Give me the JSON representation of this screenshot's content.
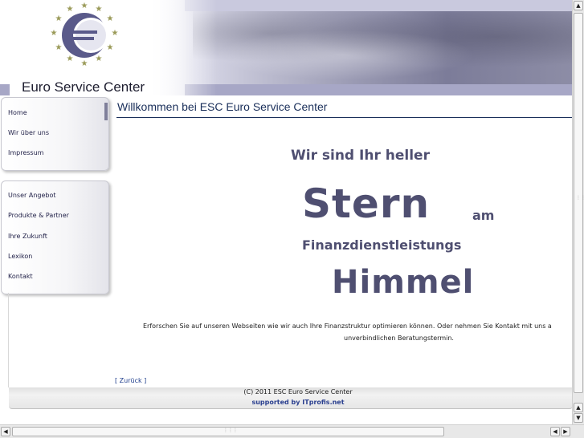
{
  "header": {
    "logo_text": "Euro Service Center"
  },
  "sidebar": {
    "group1": [
      {
        "label": "Home"
      },
      {
        "label": "Wir über uns"
      },
      {
        "label": "Impressum"
      }
    ],
    "group2": [
      {
        "label": "Unser Angebot"
      },
      {
        "label": "Produkte & Partner"
      },
      {
        "label": "Ihre Zukunft"
      },
      {
        "label": "Lexikon"
      },
      {
        "label": "Kontakt"
      }
    ]
  },
  "main": {
    "title": "Willkommen bei ESC Euro Service Center",
    "slogan": {
      "line1": "Wir sind Ihr heller",
      "word_big": "Stern",
      "word_am": "am",
      "line3": "Finanzdienstleistungs",
      "word_himmel": "Himmel"
    },
    "text_line1": "Erforschen Sie auf unseren Webseiten wie wir auch Ihre Finanzstruktur optimieren können. Oder nehmen Sie Kontakt mit uns a",
    "text_line2": "unverbindlichen Beratungstermin.",
    "back_link": "[ Zurück ]"
  },
  "footer": {
    "copyright": "(C) 2011  ESC Euro Service Center",
    "supported": "supported by ITprofis.net"
  },
  "icons": {
    "scroll_up": "arrow-up-icon",
    "scroll_down": "arrow-down-icon",
    "scroll_left": "arrow-left-icon",
    "scroll_right": "arrow-right-icon",
    "logo": "euro-stars-logo-icon"
  },
  "colors": {
    "accent": "#1a2f5a",
    "slogan": "#4f4f71",
    "link": "#2a3f8f"
  }
}
